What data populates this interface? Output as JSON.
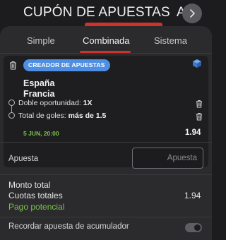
{
  "header": {
    "title": "CUPÓN DE APUESTAS",
    "title_overflow": "A",
    "next_icon": "chevron-right-icon"
  },
  "tabs": [
    {
      "label": "Simple",
      "active": false
    },
    {
      "label": "Combinada",
      "active": true
    },
    {
      "label": "Sistema",
      "active": false
    }
  ],
  "bet_card": {
    "badge": "CREADOR DE APUESTAS",
    "team_home": "España",
    "team_away": "Francia",
    "selections": [
      {
        "market": "Doble oportunidad:",
        "pick": "1X"
      },
      {
        "market": "Total de goles:",
        "pick": "más de 1.5"
      }
    ],
    "date": "5 JUN, 20:00",
    "odds": "1.94",
    "badge_color": "#4f8fe3",
    "date_color": "#7cc24a"
  },
  "stake": {
    "label": "Apuesta",
    "placeholder": "Apuesta"
  },
  "summary": {
    "total_label": "Monto total",
    "total_odds_label": "Cuotas totales",
    "total_odds_value": "1.94",
    "potential_label": "Pago potencial"
  },
  "remember": {
    "label": "Recordar apuesta de acumulador",
    "enabled": false
  },
  "colors": {
    "accent": "#d0312d",
    "positive": "#7cc24a",
    "background": "#1c1c1e",
    "panel": "#2b2b2e"
  }
}
